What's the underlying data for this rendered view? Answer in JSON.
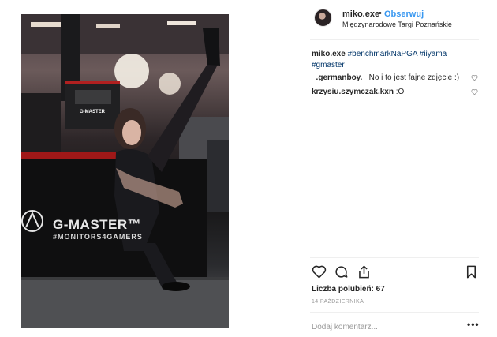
{
  "post": {
    "username": "miko.exe",
    "separator": "•",
    "follow_label": "Obserwuj",
    "location": "Międzynarodowe Targi Poznańskie",
    "caption": {
      "username": "miko.exe",
      "tags": [
        "#benchmarkNaPGA",
        "#iiyama",
        "#gmaster"
      ]
    },
    "comments": [
      {
        "username": "_.germanboy._",
        "text": "No i to jest fajne zdjęcie :)"
      },
      {
        "username": "krzysiu.szymczak.kxn",
        "text": ":O"
      }
    ],
    "likes_label": "Liczba polubień: 67",
    "date": "14 PAŹDZIERNIKA",
    "comment_placeholder": "Dodaj komentarz...",
    "more_label": "•••"
  },
  "photo": {
    "brand_logo_text": "G-MASTER™",
    "brand_slogan": "#MONITORS4GAMERS",
    "sign_text": "G-MASTER"
  },
  "colors": {
    "link": "#3897f0",
    "hashtag": "#003569",
    "muted": "#999999",
    "text": "#262626",
    "divider": "#efefef"
  },
  "icons": [
    "heart-icon",
    "comment-icon",
    "share-icon",
    "bookmark-icon",
    "small-heart-icon",
    "more-options-icon"
  ]
}
